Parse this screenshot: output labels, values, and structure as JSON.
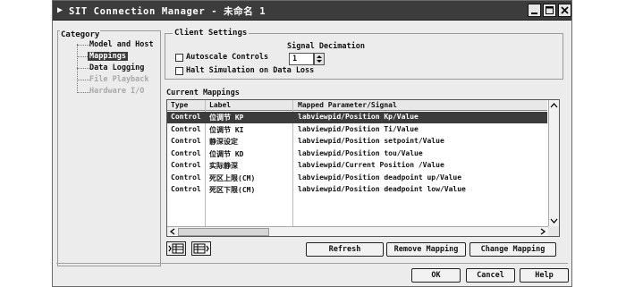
{
  "window": {
    "title": "SIT Connection Manager - 未命名 1",
    "title_bar_color": "#3c3c3c",
    "selection_color": "#3c3c3c"
  },
  "category": {
    "label": "Category",
    "items": [
      {
        "label": "Model and Host",
        "state": "normal"
      },
      {
        "label": "Mappings",
        "state": "selected"
      },
      {
        "label": "Data Logging",
        "state": "normal"
      },
      {
        "label": "File Playback",
        "state": "disabled"
      },
      {
        "label": "Hardware I/O",
        "state": "disabled"
      }
    ]
  },
  "client_settings": {
    "label": "Client Settings",
    "autoscale_label": "Autoscale Controls",
    "autoscale_checked": false,
    "halt_label": "Halt Simulation on Data Loss",
    "halt_checked": false,
    "decimation_label": "Signal Decimation",
    "decimation_value": "1"
  },
  "mappings": {
    "label": "Current Mappings",
    "columns": [
      "Type",
      "Label",
      "Mapped Parameter/Signal"
    ],
    "rows": [
      {
        "type": "Control",
        "label": "位调节 KP",
        "mapped": "labviewpid/Position Kp/Value",
        "selected": true
      },
      {
        "type": "Control",
        "label": "位调节 KI",
        "mapped": "labviewpid/Position Ti/Value",
        "selected": false
      },
      {
        "type": "Control",
        "label": "静深设定",
        "mapped": "labviewpid/Position setpoint/Value",
        "selected": false
      },
      {
        "type": "Control",
        "label": "位调节 KD",
        "mapped": "labviewpid/Position tou/Value",
        "selected": false
      },
      {
        "type": "Control",
        "label": "实际静深",
        "mapped": "labviewpid/Current Position /Value",
        "selected": false
      },
      {
        "type": "Control",
        "label": "死区上限(CM)",
        "mapped": "labviewpid/Position deadpoint up/Value",
        "selected": false
      },
      {
        "type": "Control",
        "label": "死区下限(CM)",
        "mapped": "labviewpid/Position deadpoint low/Value",
        "selected": false
      }
    ]
  },
  "actions": {
    "refresh": "Refresh",
    "remove": "Remove Mapping",
    "change": "Change Mapping"
  },
  "dialog": {
    "ok": "OK",
    "cancel": "Cancel",
    "help": "Help"
  }
}
